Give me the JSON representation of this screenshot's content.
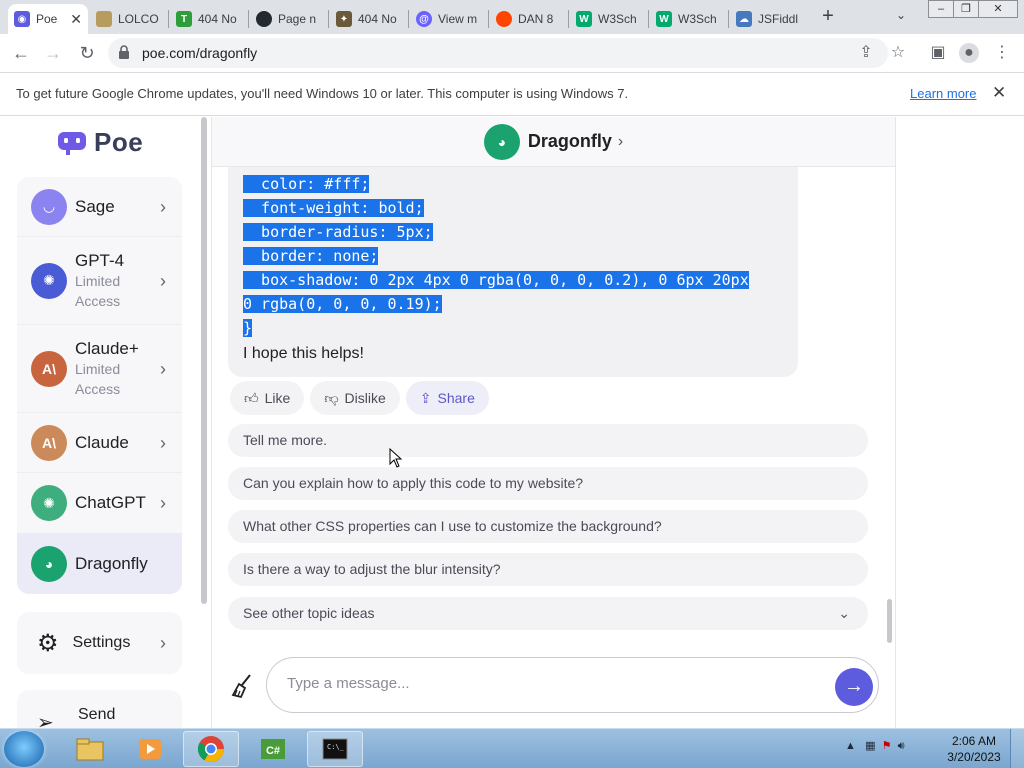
{
  "browser": {
    "tabs": [
      {
        "label": "Poe",
        "color": "#5d5cde",
        "glyph": "◉"
      },
      {
        "label": "LOLCO",
        "color": "#b89b5e",
        "glyph": "●"
      },
      {
        "label": "404 No",
        "color": "#2e9e3a",
        "glyph": "T"
      },
      {
        "label": "Page n",
        "color": "#24292f",
        "glyph": "●"
      },
      {
        "label": "404 No",
        "color": "#444",
        "glyph": "✦"
      },
      {
        "label": "View m",
        "color": "#6c63ff",
        "glyph": "@"
      },
      {
        "label": "DAN 8",
        "color": "#ff4500",
        "glyph": "●"
      },
      {
        "label": "W3Sch",
        "color": "#04aa6d",
        "glyph": "W"
      },
      {
        "label": "W3Sch",
        "color": "#04aa6d",
        "glyph": "W"
      },
      {
        "label": "JSFiddl",
        "color": "#4679bd",
        "glyph": "☁"
      }
    ],
    "url": "poe.com/dragonfly",
    "infobar": {
      "message": "To get future Google Chrome updates, you'll need Windows 10 or later. This computer is using Windows 7.",
      "learn_more": "Learn more"
    }
  },
  "sidebar": {
    "logo": "Poe",
    "bots": [
      {
        "name": "Sage",
        "sub": "",
        "color": "#8b84f0"
      },
      {
        "name": "GPT-4",
        "sub": "Limited Access",
        "color": "#4a5bd6"
      },
      {
        "name": "Claude+",
        "sub": "Limited Access",
        "color": "#c8643e"
      },
      {
        "name": "Claude",
        "sub": "",
        "color": "#cc8a5a"
      },
      {
        "name": "ChatGPT",
        "sub": "",
        "color": "#3fae7e"
      },
      {
        "name": "Dragonfly",
        "sub": "",
        "color": "#1aa36f"
      }
    ],
    "settings_label": "Settings",
    "send_label": "Send"
  },
  "chat": {
    "bot_name": "Dragonfly",
    "code_lines": [
      "  color: #fff;",
      "  font-weight: bold;",
      "  border-radius: 5px;",
      "  border: none;",
      "  box-shadow: 0 2px 4px 0 rgba(0, 0, 0, 0.2), 0 6px 20px",
      "0 rgba(0, 0, 0, 0.19);",
      "}"
    ],
    "closing_text": "I hope this helps!",
    "actions": {
      "like": "Like",
      "dislike": "Dislike",
      "share": "Share"
    },
    "suggestions": [
      "Tell me more.",
      "Can you explain how to apply this code to my website?",
      "What other CSS properties can I use to customize the background?",
      "Is there a way to adjust the blur intensity?"
    ],
    "other_topics": "See other topic ideas",
    "input_placeholder": "Type a message..."
  },
  "taskbar": {
    "time": "2:06 AM",
    "date": "3/20/2023"
  },
  "colors": {
    "accent": "#5d5cde",
    "selection": "#1a73e8"
  }
}
